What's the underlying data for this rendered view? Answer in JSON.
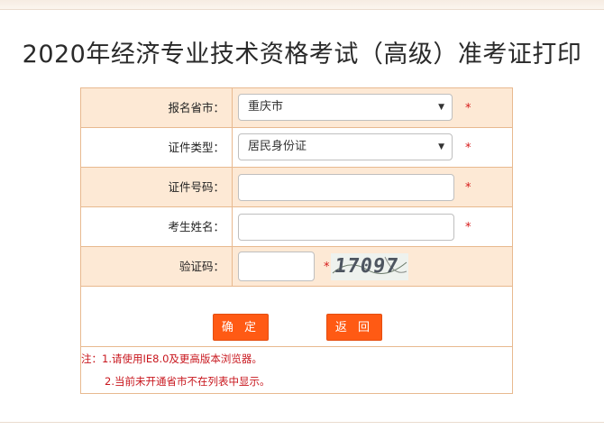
{
  "page": {
    "title": "2020年经济专业技术资格考试（高级）准考证打印"
  },
  "form": {
    "province": {
      "label": "报名省市：",
      "value": "重庆市"
    },
    "id_type": {
      "label": "证件类型：",
      "value": "居民身份证"
    },
    "id_number": {
      "label": "证件号码：",
      "value": ""
    },
    "name": {
      "label": "考生姓名：",
      "value": ""
    },
    "captcha": {
      "label": "验证码：",
      "value": "",
      "image_text": "17097"
    },
    "required_mark": "*",
    "select_arrow_icon": "▼"
  },
  "buttons": {
    "confirm": "确 定",
    "back": "返 回"
  },
  "notes": {
    "line1": "注：1.请使用IE8.0及更高版本浏览器。",
    "line2": "2.当前未开通省市不在列表中显示。"
  },
  "colors": {
    "accent": "#ff5a14",
    "row_shade": "#fde9d5",
    "border": "#e8b98f",
    "required": "#d61a1a"
  }
}
